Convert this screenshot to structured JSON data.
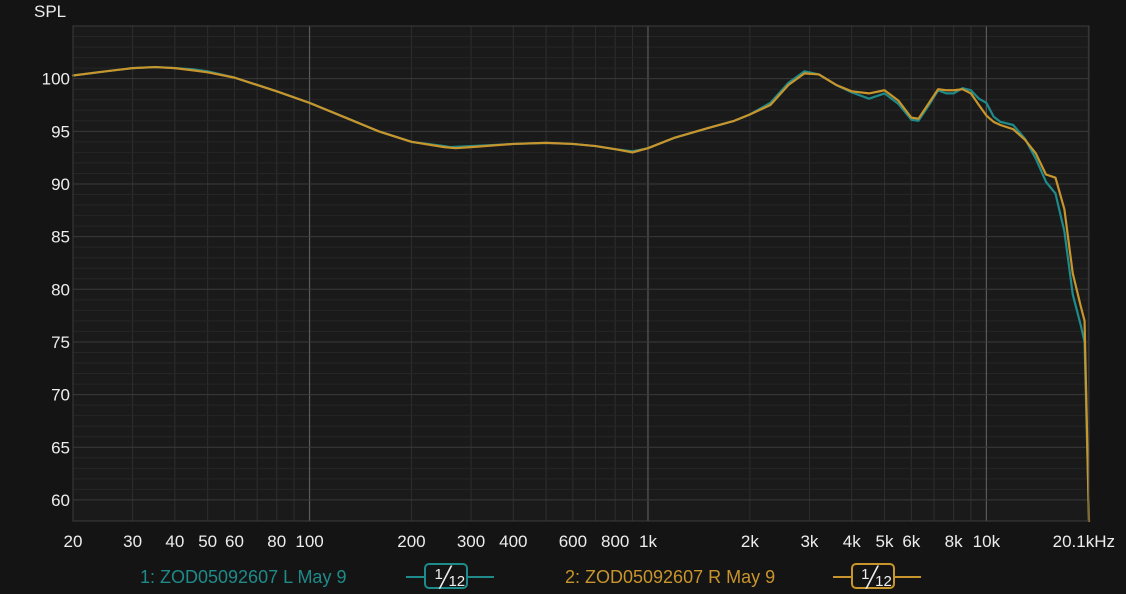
{
  "chart_data": {
    "type": "line",
    "ylabel": "SPL",
    "xscale": "log",
    "xlim": [
      20,
      20100
    ],
    "ylim": [
      58,
      105
    ],
    "grid": true,
    "xticks": [
      {
        "v": 20,
        "label": "20"
      },
      {
        "v": 30,
        "label": "30"
      },
      {
        "v": 40,
        "label": "40"
      },
      {
        "v": 50,
        "label": "50"
      },
      {
        "v": 60,
        "label": "60"
      },
      {
        "v": 80,
        "label": "80"
      },
      {
        "v": 100,
        "label": "100"
      },
      {
        "v": 200,
        "label": "200"
      },
      {
        "v": 300,
        "label": "300"
      },
      {
        "v": 400,
        "label": "400"
      },
      {
        "v": 600,
        "label": "600"
      },
      {
        "v": 800,
        "label": "800"
      },
      {
        "v": 1000,
        "label": "1k"
      },
      {
        "v": 2000,
        "label": "2k"
      },
      {
        "v": 3000,
        "label": "3k"
      },
      {
        "v": 4000,
        "label": "4k"
      },
      {
        "v": 5000,
        "label": "5k"
      },
      {
        "v": 6000,
        "label": "6k"
      },
      {
        "v": 8000,
        "label": "8k"
      },
      {
        "v": 10000,
        "label": "10k"
      },
      {
        "v": 20100,
        "label": "20.1kHz"
      }
    ],
    "yticks": [
      60,
      65,
      70,
      75,
      80,
      85,
      90,
      95,
      100
    ],
    "series": [
      {
        "name": "1: ZOD05092607 L May 9",
        "color": "#1f8a8a",
        "points": [
          [
            20,
            100.3
          ],
          [
            25,
            100.7
          ],
          [
            30,
            101.0
          ],
          [
            35,
            101.1
          ],
          [
            40,
            101.0
          ],
          [
            45,
            100.9
          ],
          [
            50,
            100.7
          ],
          [
            60,
            100.1
          ],
          [
            70,
            99.4
          ],
          [
            80,
            98.8
          ],
          [
            100,
            97.7
          ],
          [
            130,
            96.2
          ],
          [
            160,
            95.0
          ],
          [
            200,
            94.0
          ],
          [
            250,
            93.6
          ],
          [
            260,
            93.5
          ],
          [
            300,
            93.6
          ],
          [
            400,
            93.8
          ],
          [
            500,
            93.9
          ],
          [
            600,
            93.8
          ],
          [
            700,
            93.6
          ],
          [
            800,
            93.3
          ],
          [
            900,
            93.1
          ],
          [
            1000,
            93.4
          ],
          [
            1200,
            94.4
          ],
          [
            1500,
            95.3
          ],
          [
            1800,
            96.0
          ],
          [
            2000,
            96.6
          ],
          [
            2300,
            97.7
          ],
          [
            2600,
            99.6
          ],
          [
            2900,
            100.7
          ],
          [
            3200,
            100.4
          ],
          [
            3600,
            99.4
          ],
          [
            4000,
            98.7
          ],
          [
            4500,
            98.1
          ],
          [
            5000,
            98.6
          ],
          [
            5500,
            97.6
          ],
          [
            6000,
            96.1
          ],
          [
            6300,
            96.0
          ],
          [
            6800,
            97.6
          ],
          [
            7200,
            98.9
          ],
          [
            7600,
            98.6
          ],
          [
            8000,
            98.6
          ],
          [
            8500,
            99.1
          ],
          [
            9000,
            98.9
          ],
          [
            9500,
            98.1
          ],
          [
            10000,
            97.7
          ],
          [
            10500,
            96.4
          ],
          [
            11000,
            95.9
          ],
          [
            12000,
            95.6
          ],
          [
            13000,
            94.3
          ],
          [
            14000,
            92.4
          ],
          [
            15000,
            90.2
          ],
          [
            16000,
            89.1
          ],
          [
            17000,
            85.5
          ],
          [
            18000,
            79.5
          ],
          [
            19000,
            76.6
          ],
          [
            19500,
            75.0
          ],
          [
            20100,
            58.0
          ]
        ]
      },
      {
        "name": "2: ZOD05092607 R May 9",
        "color": "#c8952c",
        "points": [
          [
            20,
            100.3
          ],
          [
            25,
            100.7
          ],
          [
            30,
            101.0
          ],
          [
            35,
            101.1
          ],
          [
            40,
            101.0
          ],
          [
            45,
            100.8
          ],
          [
            50,
            100.6
          ],
          [
            60,
            100.1
          ],
          [
            70,
            99.4
          ],
          [
            80,
            98.8
          ],
          [
            100,
            97.7
          ],
          [
            130,
            96.2
          ],
          [
            160,
            95.0
          ],
          [
            200,
            94.0
          ],
          [
            250,
            93.5
          ],
          [
            270,
            93.4
          ],
          [
            300,
            93.5
          ],
          [
            400,
            93.8
          ],
          [
            500,
            93.9
          ],
          [
            600,
            93.8
          ],
          [
            700,
            93.6
          ],
          [
            800,
            93.3
          ],
          [
            900,
            93.0
          ],
          [
            1000,
            93.4
          ],
          [
            1200,
            94.4
          ],
          [
            1500,
            95.3
          ],
          [
            1800,
            96.0
          ],
          [
            2000,
            96.6
          ],
          [
            2300,
            97.5
          ],
          [
            2600,
            99.4
          ],
          [
            2900,
            100.5
          ],
          [
            3200,
            100.4
          ],
          [
            3600,
            99.4
          ],
          [
            4000,
            98.8
          ],
          [
            4500,
            98.6
          ],
          [
            5000,
            98.9
          ],
          [
            5500,
            97.9
          ],
          [
            6000,
            96.3
          ],
          [
            6300,
            96.2
          ],
          [
            6800,
            97.8
          ],
          [
            7200,
            99.0
          ],
          [
            7600,
            98.9
          ],
          [
            8000,
            98.9
          ],
          [
            8500,
            99.0
          ],
          [
            9000,
            98.6
          ],
          [
            9500,
            97.5
          ],
          [
            10000,
            96.5
          ],
          [
            10500,
            95.9
          ],
          [
            11000,
            95.6
          ],
          [
            12000,
            95.2
          ],
          [
            13000,
            94.2
          ],
          [
            14000,
            92.9
          ],
          [
            15000,
            90.9
          ],
          [
            16000,
            90.6
          ],
          [
            17000,
            87.6
          ],
          [
            18000,
            81.5
          ],
          [
            19000,
            78.4
          ],
          [
            19500,
            77.0
          ],
          [
            20100,
            58.0
          ]
        ]
      }
    ]
  },
  "legend": {
    "items": [
      {
        "label": "1: ZOD05092607 L May 9",
        "color": "#1f8a8a",
        "smoothing": {
          "num": "1",
          "den": "12"
        }
      },
      {
        "label": "2: ZOD05092607 R May 9",
        "color": "#c8952c",
        "smoothing": {
          "num": "1",
          "den": "12"
        }
      }
    ]
  }
}
